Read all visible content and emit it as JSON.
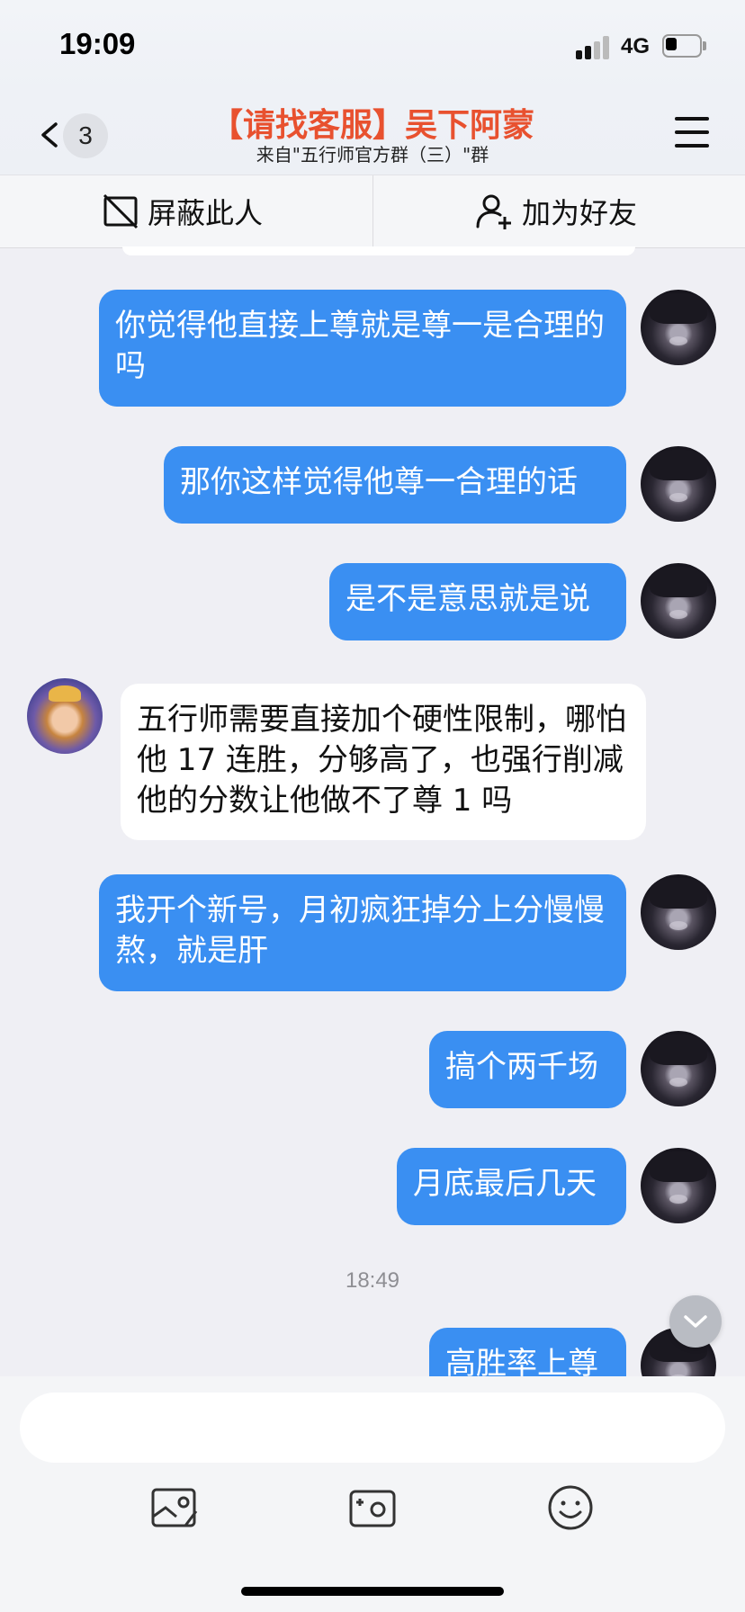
{
  "status_bar": {
    "time": "19:09",
    "network": "4G"
  },
  "header": {
    "back_badge": "3",
    "title": "【请找客服】吴下阿蒙",
    "subtitle": "来自\"五行师官方群（三）\"群"
  },
  "actions": {
    "block_label": "屏蔽此人",
    "add_friend_label": "加为好友"
  },
  "messages": [
    {
      "side": "out",
      "text": "你觉得他直接上尊就是尊一是合理的吗"
    },
    {
      "side": "out",
      "text": "那你这样觉得他尊一合理的话"
    },
    {
      "side": "out",
      "text": "是不是意思就是说"
    },
    {
      "side": "in",
      "text": "五行师需要直接加个硬性限制，哪怕他 17 连胜，分够高了，也强行削减他的分数让他做不了尊 1 吗"
    },
    {
      "side": "out",
      "text": "我开个新号，月初疯狂掉分上分慢慢熬，就是肝"
    },
    {
      "side": "out",
      "text": "搞个两千场"
    },
    {
      "side": "out",
      "text": "月底最后几天"
    },
    {
      "side": "out",
      "text": "高胜率上尊"
    }
  ],
  "timestamp": "18:49",
  "input": {
    "placeholder": ""
  },
  "icons": {
    "signal": "signal-icon",
    "battery": "battery-icon",
    "back": "chevron-left-icon",
    "menu": "hamburger-menu-icon",
    "block": "block-user-icon",
    "add_friend": "add-user-icon",
    "scroll_down": "chevron-down-icon",
    "photo": "image-icon",
    "camera": "camera-icon",
    "emoji": "emoji-icon"
  },
  "colors": {
    "title": "#e8512f",
    "outgoing_bubble": "#3a8ff2",
    "incoming_bubble": "#ffffff",
    "background": "#efeff4"
  }
}
